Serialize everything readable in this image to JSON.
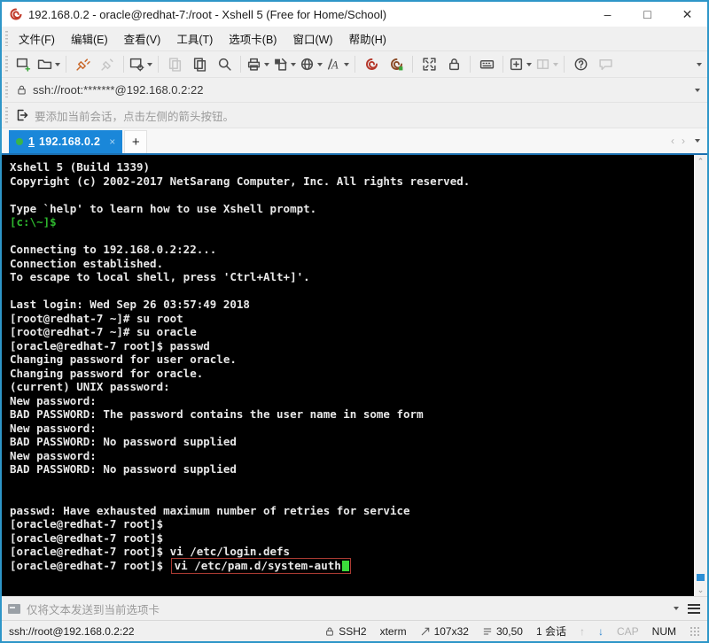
{
  "window": {
    "title": "192.168.0.2 - oracle@redhat-7:/root - Xshell 5 (Free for Home/School)",
    "controls": {
      "minimize": "–",
      "maximize": "□",
      "close": "✕"
    }
  },
  "menubar": {
    "items": [
      {
        "label": "文件(F)"
      },
      {
        "label": "编辑(E)"
      },
      {
        "label": "查看(V)"
      },
      {
        "label": "工具(T)"
      },
      {
        "label": "选项卡(B)"
      },
      {
        "label": "窗口(W)"
      },
      {
        "label": "帮助(H)"
      }
    ]
  },
  "toolbar": {
    "buttons": [
      "new-session",
      "open-session",
      "reconnect",
      "disconnect",
      "session-properties",
      "copy",
      "paste",
      "find",
      "print",
      "color-scheme",
      "open-web",
      "font",
      "xshell",
      "xftp",
      "fullscreen",
      "lock-screen",
      "virtual-keyboard",
      "new-window",
      "layout",
      "help",
      "feedback"
    ]
  },
  "addressbar": {
    "value": "ssh://root:*******@192.168.0.2:22"
  },
  "quickbar": {
    "hint": "要添加当前会话，点击左侧的箭头按钮。"
  },
  "tabbar": {
    "tabs": [
      {
        "number": "1",
        "label": "192.168.0.2",
        "active": true,
        "close": "×"
      }
    ],
    "new_tab": "+"
  },
  "terminal": {
    "lines": [
      {
        "text": "Xshell 5 (Build 1339)"
      },
      {
        "text": "Copyright (c) 2002-2017 NetSarang Computer, Inc. All rights reserved."
      },
      {
        "text": ""
      },
      {
        "text": "Type `help' to learn how to use Xshell prompt."
      },
      {
        "text": "[c:\\~]$",
        "color": "green"
      },
      {
        "text": ""
      },
      {
        "text": "Connecting to 192.168.0.2:22..."
      },
      {
        "text": "Connection established."
      },
      {
        "text": "To escape to local shell, press 'Ctrl+Alt+]'."
      },
      {
        "text": ""
      },
      {
        "text": "Last login: Wed Sep 26 03:57:49 2018"
      },
      {
        "text": "[root@redhat-7 ~]# su root"
      },
      {
        "text": "[root@redhat-7 ~]# su oracle"
      },
      {
        "text": "[oracle@redhat-7 root]$ passwd"
      },
      {
        "text": "Changing password for user oracle."
      },
      {
        "text": "Changing password for oracle."
      },
      {
        "text": "(current) UNIX password:"
      },
      {
        "text": "New password:"
      },
      {
        "text": "BAD PASSWORD: The password contains the user name in some form"
      },
      {
        "text": "New password:"
      },
      {
        "text": "BAD PASSWORD: No password supplied"
      },
      {
        "text": "New password:"
      },
      {
        "text": "BAD PASSWORD: No password supplied"
      },
      {
        "text": ""
      },
      {
        "text": ""
      },
      {
        "text": "passwd: Have exhausted maximum number of retries for service"
      },
      {
        "text": "[oracle@redhat-7 root]$"
      },
      {
        "text": "[oracle@redhat-7 root]$"
      },
      {
        "text": "[oracle@redhat-7 root]$ vi /etc/login.defs"
      },
      {
        "segments": [
          {
            "text": "[oracle@redhat-7 root]$ "
          },
          {
            "text": "vi /etc/pam.d/system-auth",
            "boxed": true,
            "cursor": true
          }
        ]
      }
    ]
  },
  "sendbar": {
    "label": "仅将文本发送到当前选项卡"
  },
  "statusbar": {
    "url": "ssh://root@192.168.0.2:22",
    "protocol": "SSH2",
    "term_type": "xterm",
    "size": "107x32",
    "cursor_pos": "30,50",
    "sessions": "1 会话",
    "cap": "CAP",
    "num": "NUM"
  }
}
